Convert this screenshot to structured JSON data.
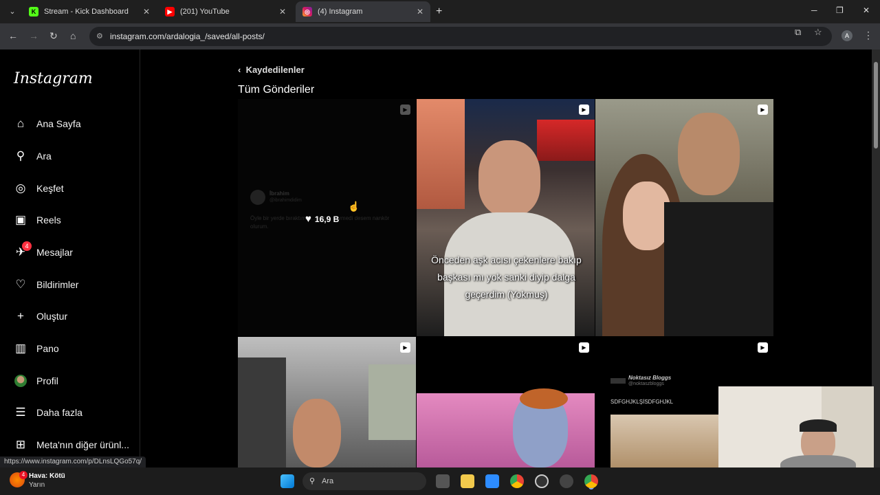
{
  "browser": {
    "tabs": [
      {
        "label": "Stream - Kick Dashboard",
        "icon": "kick-icon"
      },
      {
        "label": "(201) YouTube",
        "icon": "youtube-icon"
      },
      {
        "label": "(4) Instagram",
        "icon": "instagram-icon"
      }
    ],
    "url": "instagram.com/ardalogia_/saved/all-posts/",
    "profile_initial": "A",
    "status_url": "https://www.instagram.com/p/DLnsLQGo57q/"
  },
  "sidebar": {
    "logo": "Instagram",
    "items": [
      {
        "label": "Ana Sayfa",
        "icon": "home-icon"
      },
      {
        "label": "Ara",
        "icon": "search-icon"
      },
      {
        "label": "Keşfet",
        "icon": "compass-icon"
      },
      {
        "label": "Reels",
        "icon": "reels-icon"
      },
      {
        "label": "Mesajlar",
        "icon": "messenger-icon",
        "badge": "4"
      },
      {
        "label": "Bildirimler",
        "icon": "heart-icon"
      },
      {
        "label": "Oluştur",
        "icon": "plus-icon"
      },
      {
        "label": "Pano",
        "icon": "dashboard-icon"
      },
      {
        "label": "Profil",
        "icon": "profile-avatar"
      },
      {
        "label": "Daha fazla",
        "icon": "menu-icon"
      },
      {
        "label": "Meta'nın diğer ürünl...",
        "icon": "apps-icon"
      }
    ]
  },
  "main": {
    "back_label": "Kaydedilenler",
    "title": "Tüm Gönderiler",
    "posts": [
      {
        "type": "text-post",
        "author": "İbrahim",
        "handle": "@ibrahimdidim",
        "text": "Öyle bir yerde bıraktım ki... aptal, sevmedi desem nankör olurum.",
        "likes": "16,9 B"
      },
      {
        "type": "reel",
        "caption": "Önceden aşk acısı çekenlere bakıp başkası mı yok sanki diyip dalga geçerdim (Yokmuş)"
      },
      {
        "type": "reel"
      },
      {
        "type": "reel"
      },
      {
        "type": "reel"
      },
      {
        "type": "reel",
        "author": "Noktasız Bloggs",
        "handle": "@noktaszbloggs",
        "text": "SDFGHJKLŞİSDFGHJKL"
      }
    ]
  },
  "taskbar": {
    "weather_title": "Hava: Kötü",
    "weather_sub": "Yarın",
    "weather_badge": "4",
    "search_placeholder": "Ara"
  },
  "colors": {
    "accent_badge": "#ff3040",
    "background": "#000000"
  }
}
